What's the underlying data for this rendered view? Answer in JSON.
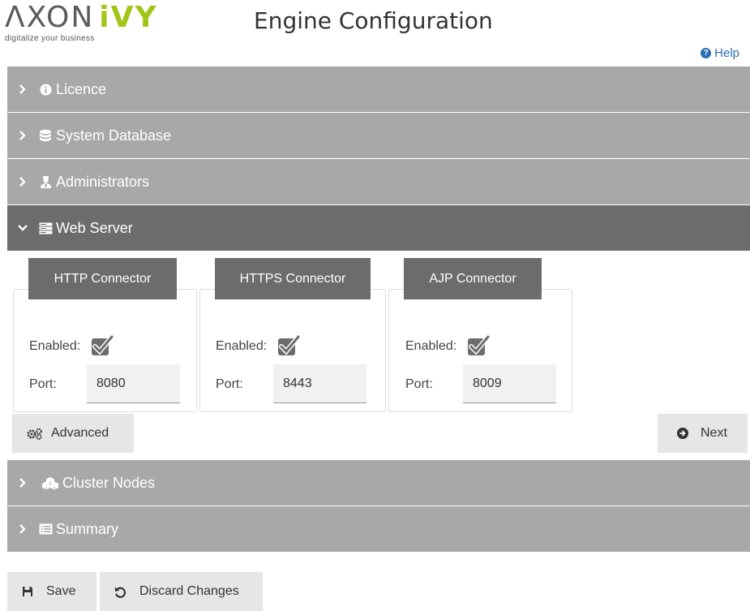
{
  "brand": {
    "name_part1": "ΛXON",
    "name_part2": "iVY",
    "tagline": "digitalize your business"
  },
  "page": {
    "title": "Engine Configuration"
  },
  "help": {
    "label": "Help"
  },
  "sections": {
    "licence": "Licence",
    "system_database": "System Database",
    "administrators": "Administrators",
    "web_server": "Web Server",
    "cluster_nodes": "Cluster Nodes",
    "summary": "Summary"
  },
  "web_server": {
    "connectors": [
      {
        "title": "HTTP Connector",
        "enabled_label": "Enabled:",
        "enabled": true,
        "port_label": "Port:",
        "port": "8080"
      },
      {
        "title": "HTTPS Connector",
        "enabled_label": "Enabled:",
        "enabled": true,
        "port_label": "Port:",
        "port": "8443"
      },
      {
        "title": "AJP Connector",
        "enabled_label": "Enabled:",
        "enabled": true,
        "port_label": "Port:",
        "port": "8009"
      }
    ],
    "advanced_label": "Advanced",
    "next_label": "Next"
  },
  "footer": {
    "save_label": "Save",
    "discard_label": "Discard Changes"
  },
  "colors": {
    "section_bg": "#a8a8a8",
    "section_active_bg": "#6c6c6c",
    "brand_green": "#a2c617",
    "help_blue": "#2a6db8",
    "button_bg": "#e6e6e6"
  },
  "icons": {
    "licence": "info-circle-icon",
    "system_database": "database-icon",
    "administrators": "admin-user-icon",
    "web_server": "server-icon",
    "cluster_nodes": "cluster-cubes-icon",
    "summary": "list-alt-icon",
    "advanced": "gears-icon",
    "next": "arrow-circle-right-icon",
    "save": "floppy-disk-icon",
    "discard": "undo-icon",
    "help": "question-circle-icon"
  }
}
